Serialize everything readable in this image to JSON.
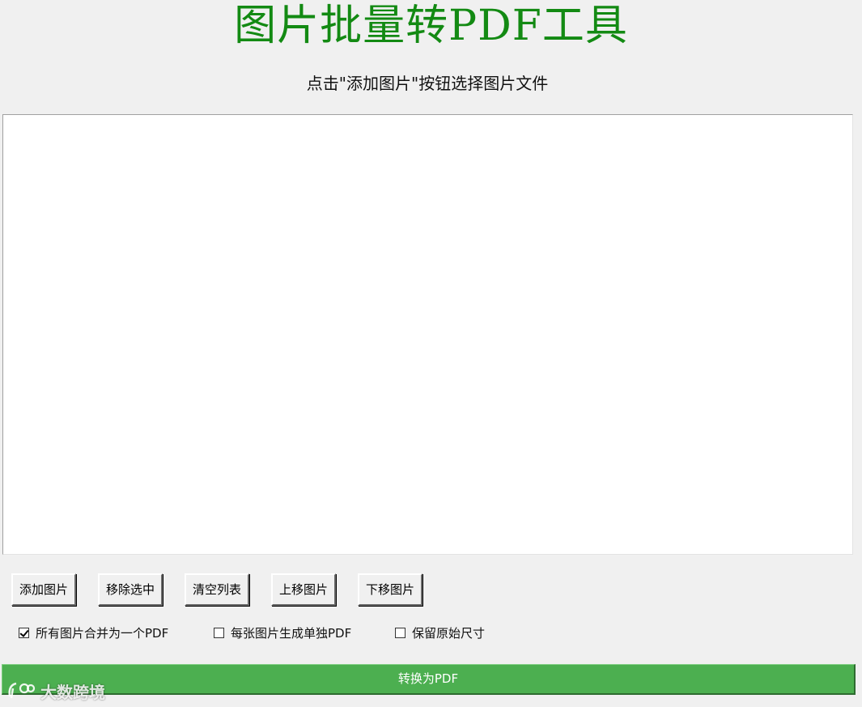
{
  "app": {
    "title": "图片批量转PDF工具",
    "subtitle": "点击\"添加图片\"按钮选择图片文件"
  },
  "file_list": {
    "items": []
  },
  "toolbar": {
    "add_label": "添加图片",
    "remove_label": "移除选中",
    "clear_label": "清空列表",
    "move_up_label": "上移图片",
    "move_down_label": "下移图片"
  },
  "options": {
    "merge": {
      "label": "所有图片合并为一个PDF",
      "checked": true
    },
    "separate": {
      "label": "每张图片生成单独PDF",
      "checked": false
    },
    "keep_size": {
      "label": "保留原始尺寸",
      "checked": false
    }
  },
  "convert": {
    "label": "转换为PDF",
    "color": "#4caf50"
  },
  "watermark": {
    "text": "大数跨境"
  },
  "colors": {
    "title": "#138a13",
    "background": "#f0f0f0"
  }
}
